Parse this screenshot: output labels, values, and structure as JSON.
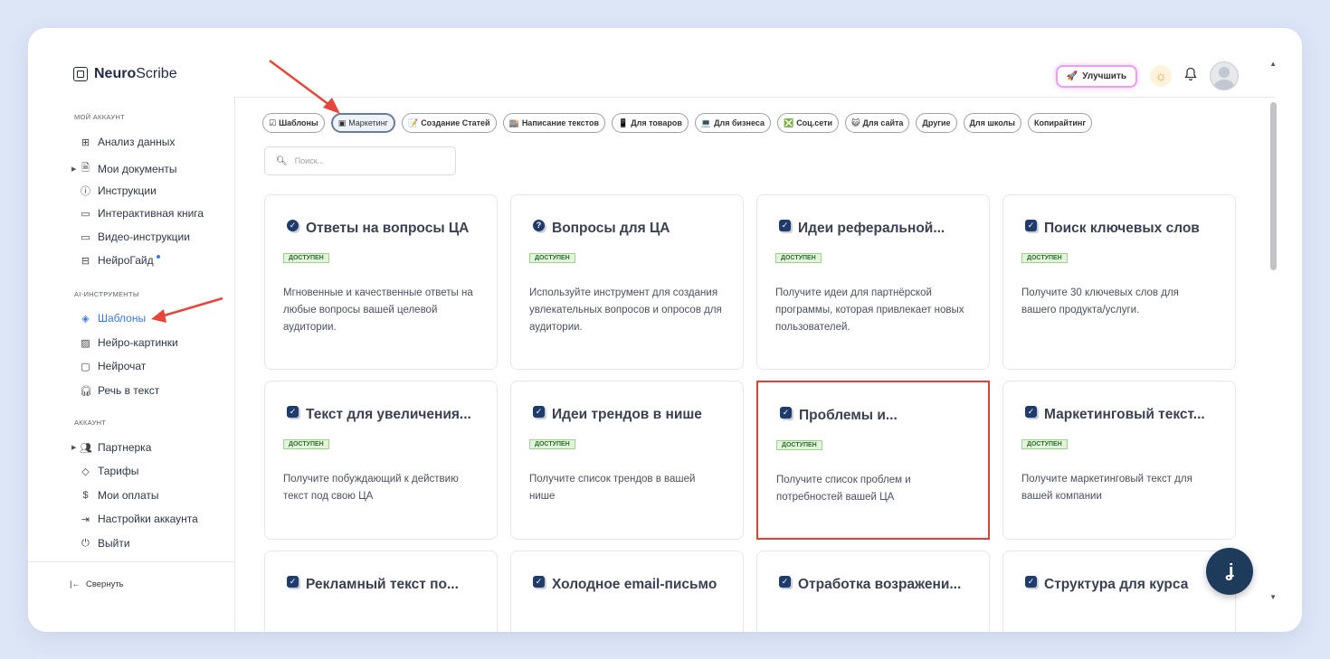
{
  "logo": {
    "brand_bold": "Neuro",
    "brand_rest": "Scribe"
  },
  "header": {
    "upgrade_label": "Улучшить",
    "icons": [
      "rocket-icon",
      "sun-icon",
      "bell-icon"
    ]
  },
  "sidebar": {
    "sections": [
      {
        "title": "МОЙ АККАУНТ",
        "items": [
          {
            "label": "Анализ данных",
            "icon": "grid-icon"
          },
          {
            "label": "Мои документы",
            "icon": "document-icon",
            "expandable": true
          },
          {
            "label": "Инструкции",
            "icon": "help-icon"
          },
          {
            "label": "Интерактивная книга",
            "icon": "book-icon"
          },
          {
            "label": "Видео-инструкции",
            "icon": "video-icon"
          },
          {
            "label": "НейроГайд",
            "icon": "layout-icon"
          }
        ]
      },
      {
        "title": "AI-ИНСТРУМЕНТЫ",
        "items": [
          {
            "label": "Шаблоны",
            "icon": "layers-icon",
            "active": true
          },
          {
            "label": "Нейро-картинки",
            "icon": "image-icon"
          },
          {
            "label": "Нейрочат",
            "icon": "chat-icon"
          },
          {
            "label": "Речь в текст",
            "icon": "headphones-icon"
          }
        ]
      },
      {
        "title": "АККАУНТ",
        "items": [
          {
            "label": "Партнерка",
            "icon": "users-icon",
            "expandable": true
          },
          {
            "label": "Тарифы",
            "icon": "tag-icon"
          },
          {
            "label": "Мои оплаты",
            "icon": "dollar-icon"
          },
          {
            "label": "Настройки аккаунта",
            "icon": "logout-icon"
          },
          {
            "label": "Выйти",
            "icon": "power-icon"
          }
        ]
      }
    ],
    "collapse_label": "Свернуть"
  },
  "filters": [
    {
      "label": "Шаблоны",
      "emoji": "☑"
    },
    {
      "label": "Маркетинг",
      "emoji": "▣",
      "active": true
    },
    {
      "label": "Создание Статей",
      "emoji": "📝"
    },
    {
      "label": "Написание текстов",
      "emoji": "🏬"
    },
    {
      "label": "Для товаров",
      "emoji": "📱"
    },
    {
      "label": "Для бизнеса",
      "emoji": "💻"
    },
    {
      "label": "Соц.сети",
      "emoji": "❎"
    },
    {
      "label": "Для сайта",
      "emoji": "😺"
    },
    {
      "label": "Другие",
      "emoji": ""
    },
    {
      "label": "Для школы",
      "emoji": ""
    },
    {
      "label": "Копирайтинг",
      "emoji": ""
    }
  ],
  "search": {
    "placeholder": "Поиск..."
  },
  "badge_label": "ДОСТУПЕН",
  "cards": [
    {
      "title": "Ответы на вопросы ЦА",
      "desc": "Мгновенные и качественные ответы на любые вопросы вашей целевой аудитории.",
      "icon": "check-circle-icon"
    },
    {
      "title": "Вопросы для ЦА",
      "desc": "Используйте инструмент для создания увлекательных вопросов и опросов для аудитории.",
      "icon": "question-circle-icon"
    },
    {
      "title": "Идеи реферальной...",
      "desc": "Получите идеи для партнёрской программы, которая привлекает новых пользователей.",
      "icon": "checkbox-icon"
    },
    {
      "title": "Поиск ключевых слов",
      "desc": "Получите 30 ключевых слов для вашего продукта/услуги.",
      "icon": "checkbox-icon"
    },
    {
      "title": "Текст для увеличения...",
      "desc": "Получите побуждающий к действию текст под свою ЦА",
      "icon": "checkbox-icon"
    },
    {
      "title": "Идеи трендов в нише",
      "desc": "Получите список трендов в вашей нише",
      "icon": "checkbox-icon"
    },
    {
      "title": "Проблемы и...",
      "desc": "Получите список проблем и потребностей вашей ЦА",
      "icon": "checkbox-icon",
      "highlighted": true
    },
    {
      "title": "Маркетинговый текст...",
      "desc": "Получите маркетинговый текст для вашей компании",
      "icon": "checkbox-icon"
    },
    {
      "title": "Рекламный текст по...",
      "desc": "",
      "icon": "checkbox-icon"
    },
    {
      "title": "Холодное email-письмо",
      "desc": "",
      "icon": "checkbox-icon"
    },
    {
      "title": "Отработка возражени...",
      "desc": "",
      "icon": "checkbox-icon"
    },
    {
      "title": "Структура для курса",
      "desc": "",
      "icon": "checkbox-icon"
    }
  ],
  "fab_label": "ʝ"
}
